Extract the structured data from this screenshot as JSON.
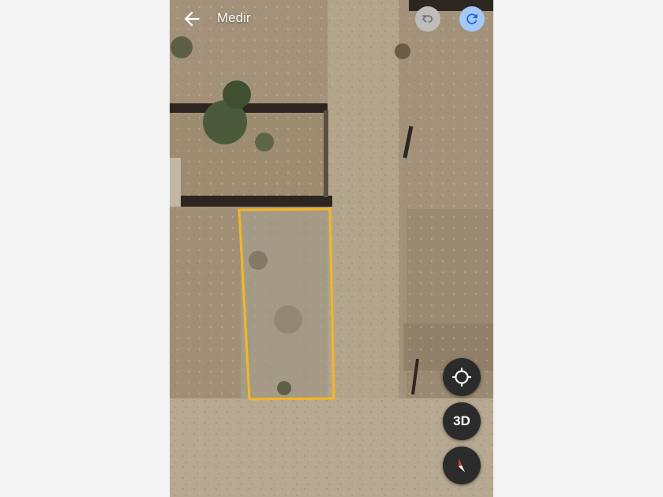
{
  "header": {
    "title": "Medir"
  },
  "controls": {
    "btn_3d_label": "3D"
  },
  "icons": {
    "back": "arrow-back-icon",
    "undo": "undo-icon",
    "redo": "redo-icon",
    "locate": "my-location-icon",
    "compass": "compass-icon"
  },
  "colors": {
    "measure_outline": "#f5b623",
    "undo_disabled": "#bdbdbd",
    "redo_active": "#a5c8f7",
    "fab_background": "#2b2b2b"
  }
}
